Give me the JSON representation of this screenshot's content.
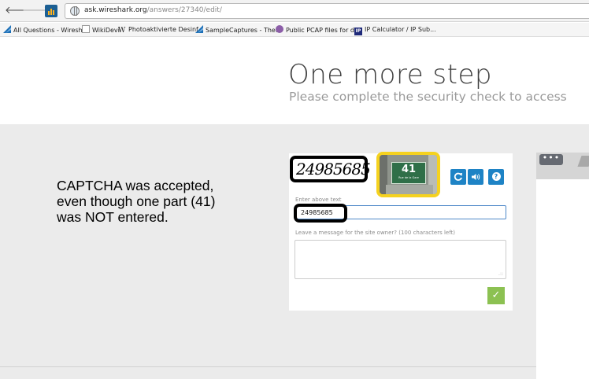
{
  "browser": {
    "back_icon": "back-arrow-icon",
    "forward_icon": "forward-arrow-icon",
    "site_badge_icon": "ask-wireshark-favicon",
    "url_host": "ask.wireshark.org",
    "url_path": "/answers/27340/edit/",
    "bookmarks": [
      {
        "label": "All Questions - Wiresh...",
        "icon": "wireshark-fin-icon"
      },
      {
        "label": "WikiDevi",
        "icon": "page-icon"
      },
      {
        "label": "Photoaktivierte Desinf...",
        "icon": "wikipedia-w-icon"
      },
      {
        "label": "SampleCaptures - The...",
        "icon": "wireshark-fin-icon"
      },
      {
        "label": "Public PCAP files for d...",
        "icon": "globe-icon"
      },
      {
        "label": "IP Calculator / IP Sub...",
        "icon": "ip-badge-icon"
      }
    ]
  },
  "page": {
    "title": "One more step",
    "subtitle": "Please complete the security check to access"
  },
  "annotation": {
    "lines": [
      "CAPTCHA was accepted,",
      "even though one part (41)",
      "was NOT entered."
    ]
  },
  "captcha": {
    "word_text": "24985685",
    "image_number": "41",
    "image_small_text": "Rue de la Gare",
    "label": "Enter above text",
    "answer_value": "24985685",
    "message_label": "Leave a message for the site owner? (100 characters left)",
    "message_value": "",
    "reload_icon": "reload-icon",
    "audio_icon": "audio-icon",
    "help_icon": "help-icon",
    "submit_icon": "checkmark-icon"
  },
  "colors": {
    "accent_blue": "#1e83c5",
    "submit_green": "#8cc152",
    "highlight_black": "#000000",
    "highlight_yellow": "#f5d21f",
    "page_gray": "#ebebeb"
  }
}
